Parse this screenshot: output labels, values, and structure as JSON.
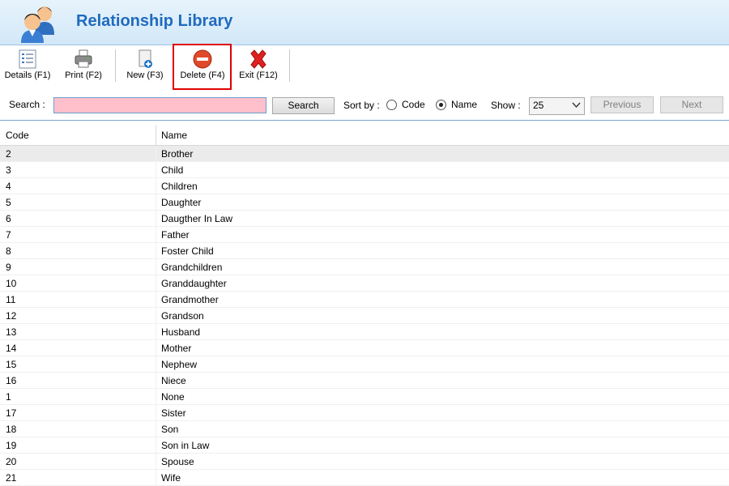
{
  "header": {
    "title": "Relationship Library",
    "icon": "people-icon"
  },
  "toolbar": {
    "buttons": [
      {
        "label": "Details (F1)",
        "icon": "details-icon"
      },
      {
        "label": "Print (F2)",
        "icon": "printer-icon"
      },
      {
        "label": "New (F3)",
        "icon": "new-document-icon"
      },
      {
        "label": "Delete (F4)",
        "icon": "delete-icon"
      },
      {
        "label": "Exit (F12)",
        "icon": "exit-x-icon"
      }
    ]
  },
  "search": {
    "label": "Search :",
    "value": "",
    "button_label": "Search",
    "sort_label": "Sort by :",
    "sort_options": [
      "Code",
      "Name"
    ],
    "sort_selected": "Name",
    "show_label": "Show :",
    "show_value": "25",
    "previous_label": "Previous",
    "next_label": "Next"
  },
  "table": {
    "columns": [
      "Code",
      "Name"
    ],
    "rows": [
      {
        "code": "2",
        "name": "Brother"
      },
      {
        "code": "3",
        "name": "Child"
      },
      {
        "code": "4",
        "name": "Children"
      },
      {
        "code": "5",
        "name": "Daughter"
      },
      {
        "code": "6",
        "name": "Daugther In Law"
      },
      {
        "code": "7",
        "name": "Father"
      },
      {
        "code": "8",
        "name": "Foster Child"
      },
      {
        "code": "9",
        "name": "Grandchildren"
      },
      {
        "code": "10",
        "name": "Granddaughter"
      },
      {
        "code": "11",
        "name": "Grandmother"
      },
      {
        "code": "12",
        "name": "Grandson"
      },
      {
        "code": "13",
        "name": "Husband"
      },
      {
        "code": "14",
        "name": "Mother"
      },
      {
        "code": "15",
        "name": "Nephew"
      },
      {
        "code": "16",
        "name": "Niece"
      },
      {
        "code": "1",
        "name": "None"
      },
      {
        "code": "17",
        "name": "Sister"
      },
      {
        "code": "18",
        "name": "Son"
      },
      {
        "code": "19",
        "name": "Son in Law"
      },
      {
        "code": "20",
        "name": "Spouse"
      },
      {
        "code": "21",
        "name": "Wife"
      }
    ]
  },
  "colors": {
    "title": "#1f6bbf",
    "search_input_bg": "#ffc0cb",
    "highlight_border": "#e00000"
  }
}
